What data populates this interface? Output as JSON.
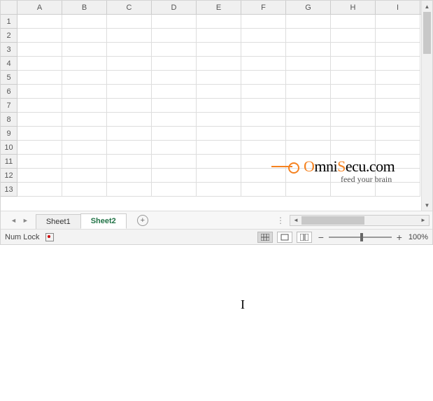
{
  "columns": [
    "A",
    "B",
    "C",
    "D",
    "E",
    "F",
    "G",
    "H",
    "I"
  ],
  "rows": [
    "1",
    "2",
    "3",
    "4",
    "5",
    "6",
    "7",
    "8",
    "9",
    "10",
    "11",
    "12",
    "13"
  ],
  "tabs": [
    {
      "label": "Sheet1",
      "active": false
    },
    {
      "label": "Sheet2",
      "active": true
    }
  ],
  "status": {
    "numlock": "Num Lock",
    "zoom": "100%"
  },
  "watermark": {
    "brand_part1": "O",
    "brand_part2": "mni",
    "brand_part3": "S",
    "brand_part4": "ecu.com",
    "tagline": "feed your brain"
  }
}
